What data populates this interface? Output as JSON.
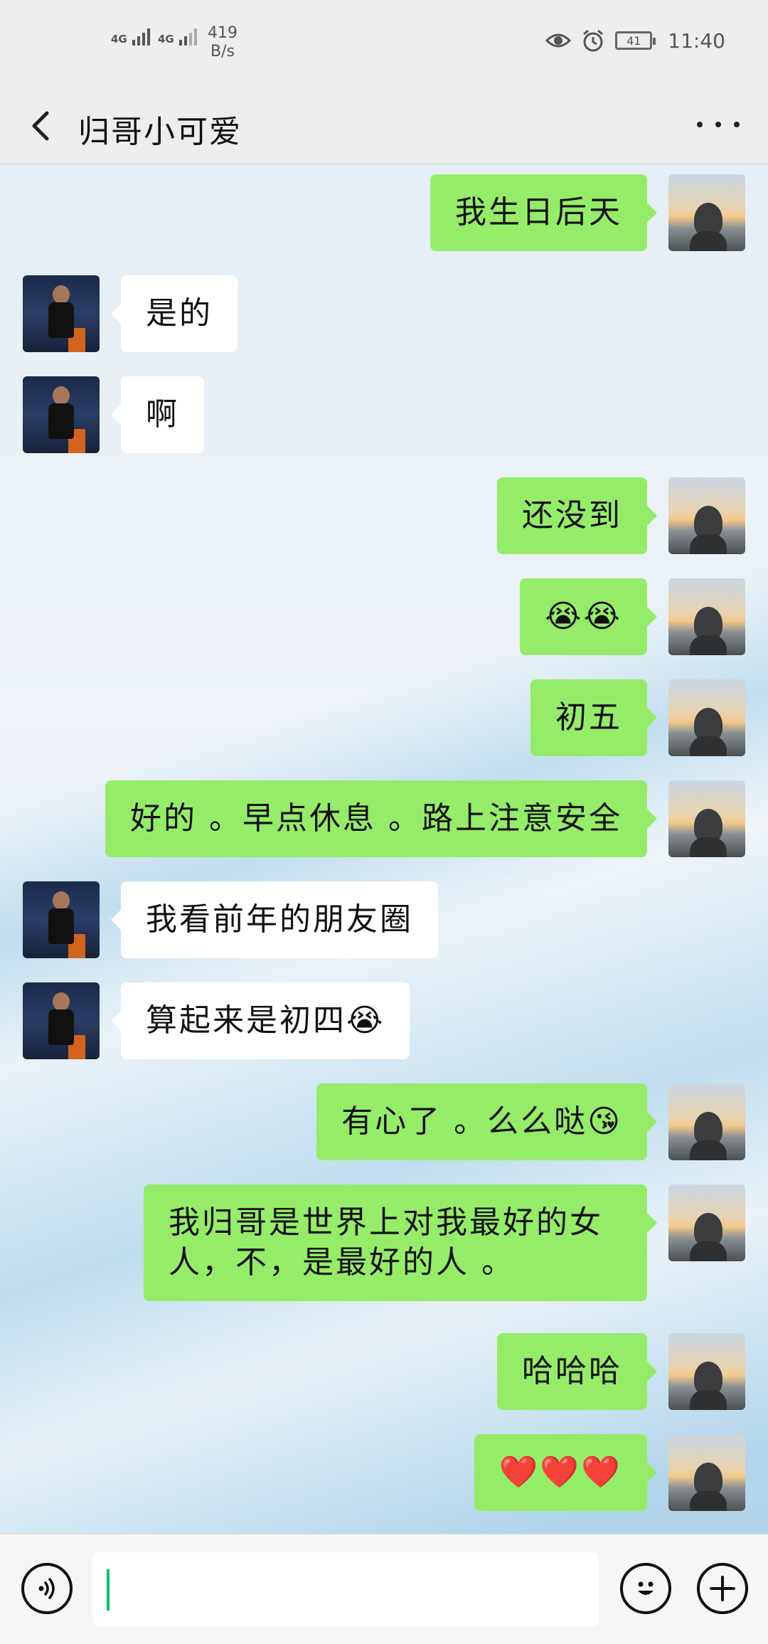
{
  "status_bar": {
    "sim1": "4G",
    "sim2": "4G",
    "net_speed_value": "419",
    "net_speed_unit": "B/s",
    "battery": "41",
    "time": "11:40",
    "icons": [
      "eye-icon",
      "alarm-icon",
      "battery-icon"
    ]
  },
  "header": {
    "title": "归哥小可爱",
    "back_icon": "chevron-left-icon",
    "more_icon": "more-dots-icon"
  },
  "messages": [
    {
      "from": "me",
      "text": "我生日后天"
    },
    {
      "from": "them",
      "text": "是的"
    },
    {
      "from": "them",
      "text": "啊"
    },
    {
      "from": "me",
      "text": "还没到"
    },
    {
      "from": "me",
      "text": "😭😭"
    },
    {
      "from": "me",
      "text": "初五"
    },
    {
      "from": "me",
      "text": "好的 。早点休息 。路上注意安全"
    },
    {
      "from": "them",
      "text": "我看前年的朋友圈"
    },
    {
      "from": "them",
      "text": "算起来是初四😭"
    },
    {
      "from": "me",
      "text": "有心了 。么么哒😘"
    },
    {
      "from": "me",
      "text": "我归哥是世界上对我最好的女人，不，是最好的人 。"
    },
    {
      "from": "me",
      "text": "哈哈哈"
    },
    {
      "from": "me",
      "text": "❤️❤️❤️"
    }
  ],
  "input_bar": {
    "value": "",
    "voice_icon": "voice-icon",
    "emoji_icon": "emoji-icon",
    "plus_icon": "plus-icon"
  },
  "colors": {
    "my_bubble": "#95ec69",
    "their_bubble": "#ffffff",
    "header_bg": "#ededed",
    "caret": "#07c160"
  }
}
